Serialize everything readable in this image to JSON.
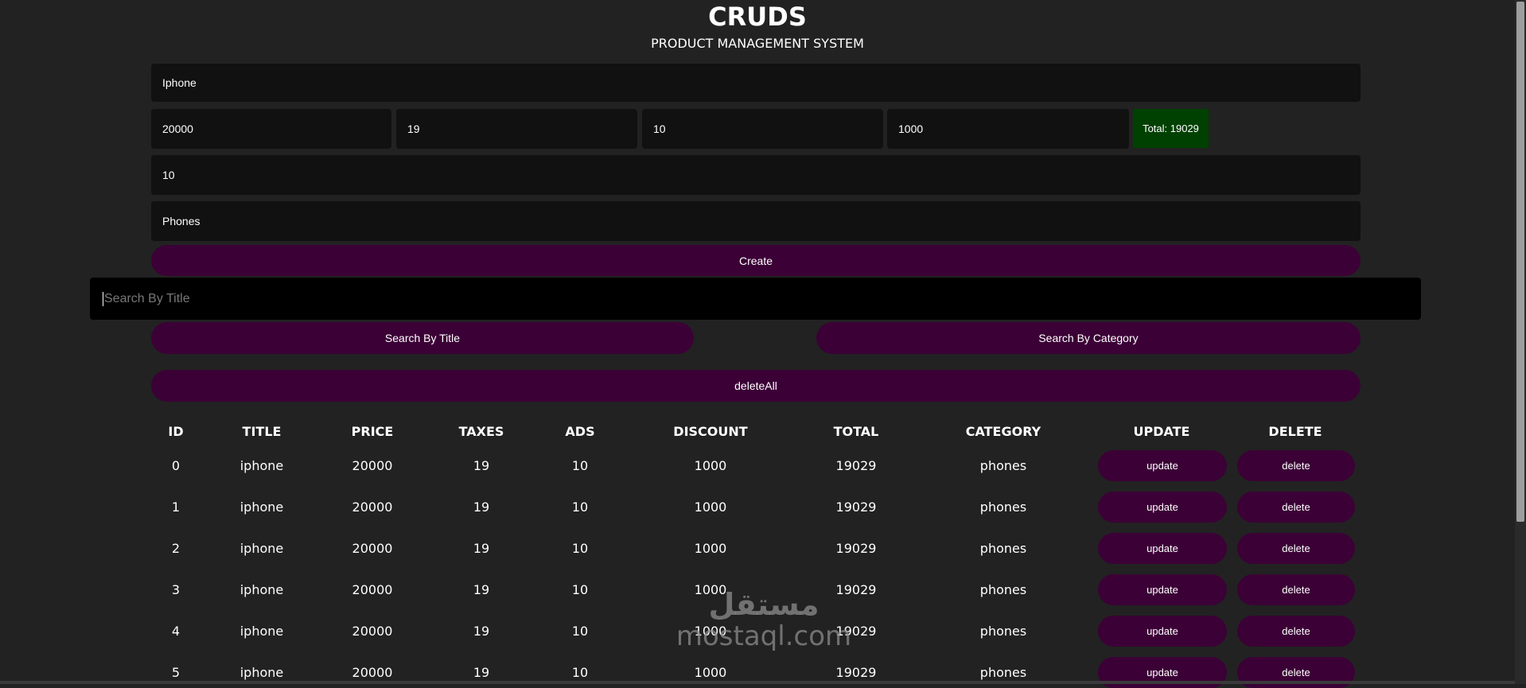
{
  "header": {
    "title": "CRUDS",
    "subtitle": "PRODUCT MANAGEMENT SYSTEM"
  },
  "form": {
    "title_value": "Iphone",
    "price_value": "20000",
    "taxes_value": "19",
    "ads_value": "10",
    "discount_value": "1000",
    "total_label": "Total: 19029",
    "count_value": "10",
    "category_value": "Phones",
    "create_label": "Create"
  },
  "search": {
    "placeholder": "Search By Title",
    "by_title_label": "Search By Title",
    "by_category_label": "Search By Category"
  },
  "delete_all_label": "deleteAll",
  "table": {
    "headers": [
      "ID",
      "TITLE",
      "PRICE",
      "TAXES",
      "ADS",
      "DISCOUNT",
      "TOTAL",
      "CATEGORY",
      "UPDATE",
      "DELETE"
    ],
    "rows": [
      [
        "0",
        "iphone",
        "20000",
        "19",
        "10",
        "1000",
        "19029",
        "phones"
      ],
      [
        "1",
        "iphone",
        "20000",
        "19",
        "10",
        "1000",
        "19029",
        "phones"
      ],
      [
        "2",
        "iphone",
        "20000",
        "19",
        "10",
        "1000",
        "19029",
        "phones"
      ],
      [
        "3",
        "iphone",
        "20000",
        "19",
        "10",
        "1000",
        "19029",
        "phones"
      ],
      [
        "4",
        "iphone",
        "20000",
        "19",
        "10",
        "1000",
        "19029",
        "phones"
      ],
      [
        "5",
        "iphone",
        "20000",
        "19",
        "10",
        "1000",
        "19029",
        "phones"
      ]
    ],
    "update_label": "update",
    "delete_label": "delete"
  },
  "watermark": {
    "arabic": "مستقل",
    "latin": "mostaql.com"
  },
  "colors": {
    "background": "#222222",
    "input": "#111111",
    "button": "#3b0036",
    "total": "#004000",
    "search": "#000000"
  }
}
